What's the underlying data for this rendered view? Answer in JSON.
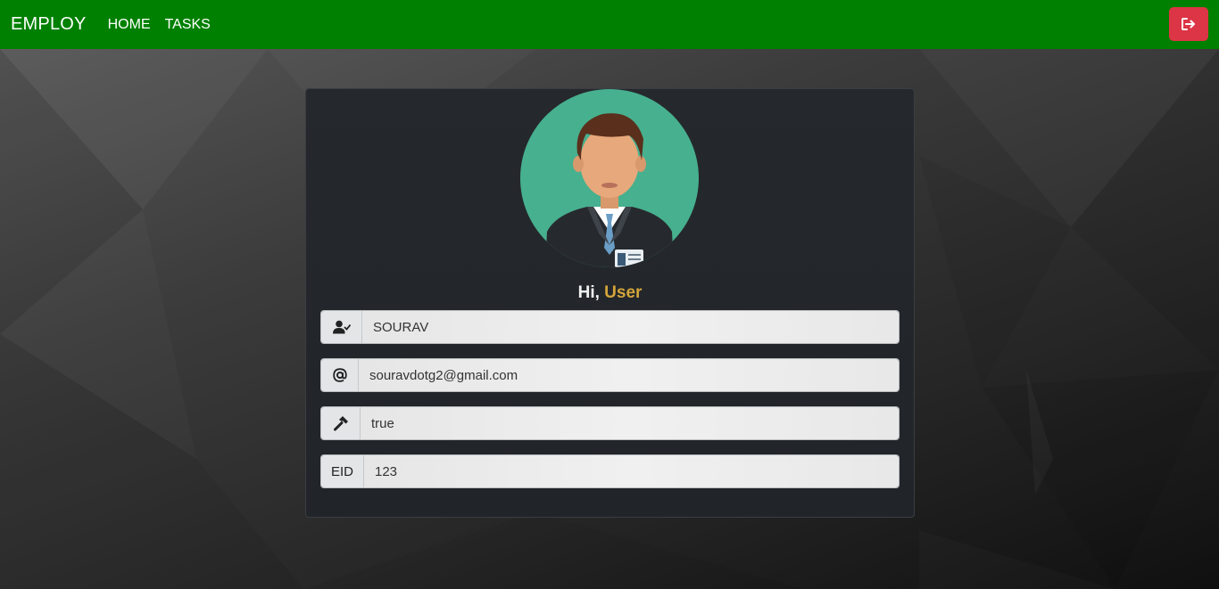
{
  "navbar": {
    "brand": "EMPLOY",
    "links": [
      {
        "label": "HOME"
      },
      {
        "label": "TASKS"
      }
    ],
    "logout_icon": "sign-out-icon"
  },
  "profile": {
    "greeting_prefix": "Hi,",
    "greeting_name": "User",
    "fields": {
      "name": {
        "icon": "user-check-icon",
        "value": "SOURAV"
      },
      "email": {
        "icon": "at-icon",
        "value": "souravdotg2@gmail.com"
      },
      "role": {
        "icon": "hammer-icon",
        "value": "true"
      },
      "eid": {
        "label": "EID",
        "value": "123"
      }
    }
  },
  "colors": {
    "navbar": "#008000",
    "logout": "#dc3545",
    "accent_name": "#d4a53a",
    "avatar_bg": "#47b08e"
  }
}
